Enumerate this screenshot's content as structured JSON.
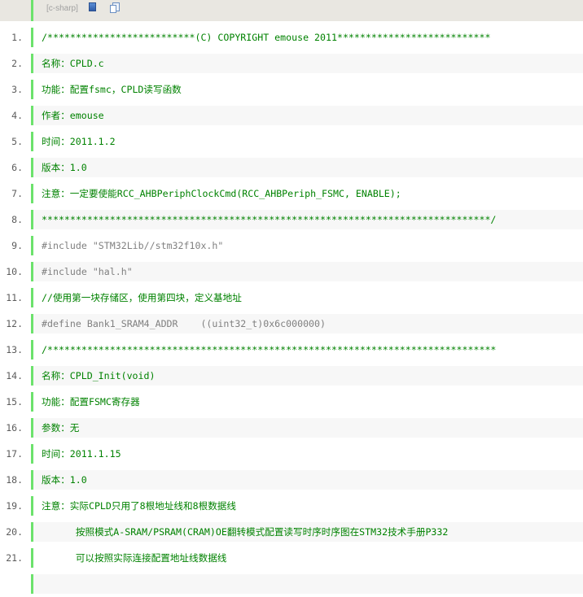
{
  "toolbar": {
    "language": "[c-sharp]",
    "icons": [
      "view-source-icon",
      "copy-icon"
    ]
  },
  "lines": [
    {
      "n": "1.",
      "text": "/**************************(C) COPYRIGHT emouse 2011***************************",
      "type": "comment"
    },
    {
      "n": "2.",
      "text": "名称：CPLD.c",
      "type": "comment"
    },
    {
      "n": "3.",
      "text": "功能：配置fsmc，CPLD读写函数",
      "type": "comment"
    },
    {
      "n": "4.",
      "text": "作者：emouse",
      "type": "comment"
    },
    {
      "n": "5.",
      "text": "时间：2011.1.2",
      "type": "comment"
    },
    {
      "n": "6.",
      "text": "版本：1.0",
      "type": "comment"
    },
    {
      "n": "7.",
      "text": "注意：一定要使能RCC_AHBPeriphClockCmd(RCC_AHBPeriph_FSMC, ENABLE);",
      "type": "comment"
    },
    {
      "n": "8.",
      "text": "*******************************************************************************/",
      "type": "comment"
    },
    {
      "n": "9.",
      "text": "#include \"STM32Lib//stm32f10x.h\"",
      "type": "preprocessor"
    },
    {
      "n": "10.",
      "text": "#include \"hal.h\"",
      "type": "preprocessor"
    },
    {
      "n": "11.",
      "text": "//使用第一块存储区，使用第四块，定义基地址",
      "type": "comment"
    },
    {
      "n": "12.",
      "text": "#define Bank1_SRAM4_ADDR    ((uint32_t)0x6c000000)",
      "type": "preprocessor"
    },
    {
      "n": "13.",
      "text": "/*******************************************************************************",
      "type": "comment"
    },
    {
      "n": "14.",
      "text": "名称：CPLD_Init(void)",
      "type": "comment"
    },
    {
      "n": "15.",
      "text": "功能：配置FSMC寄存器",
      "type": "comment"
    },
    {
      "n": "16.",
      "text": "参数：无",
      "type": "comment"
    },
    {
      "n": "17.",
      "text": "时间：2011.1.15",
      "type": "comment"
    },
    {
      "n": "18.",
      "text": "版本：1.0",
      "type": "comment"
    },
    {
      "n": "19.",
      "text": "注意：实际CPLD只用了8根地址线和8根数据线",
      "type": "comment"
    },
    {
      "n": "20.",
      "text": "      按照模式A-SRAM/PSRAM(CRAM)OE翻转模式配置读写时序时序图在STM32技术手册P332",
      "type": "comment"
    },
    {
      "n": "21.",
      "text": "      可以按照实际连接配置地址线数据线",
      "type": "comment"
    },
    {
      "n": "",
      "text": "",
      "type": "comment"
    }
  ]
}
